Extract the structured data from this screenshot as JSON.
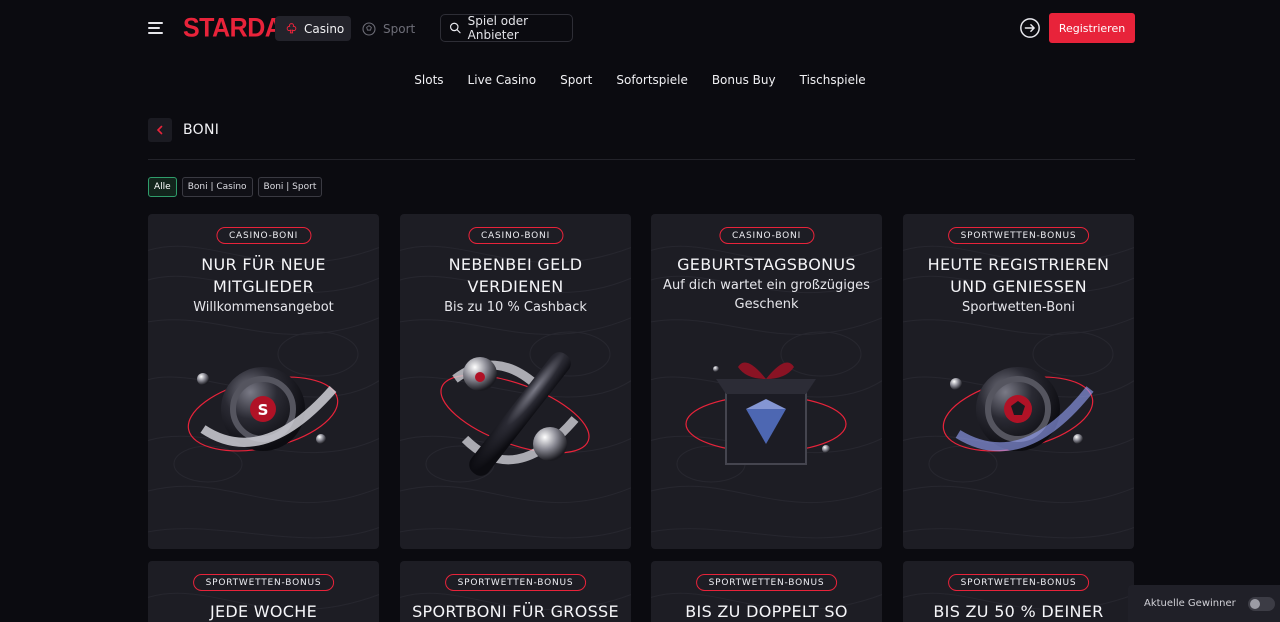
{
  "header": {
    "logo": "STARDA",
    "casino_tab": "Casino",
    "sport_tab": "Sport",
    "search_placeholder": "Spiel oder Anbieter",
    "register_label": "Registrieren"
  },
  "subnav": [
    "Slots",
    "Live Casino",
    "Sport",
    "Sofortspiele",
    "Bonus Buy",
    "Tischspiele"
  ],
  "page": {
    "title": "BONI"
  },
  "filters": [
    "Alle",
    "Boni | Casino",
    "Boni | Sport"
  ],
  "cards": [
    {
      "badge": "CASINO-BONI",
      "title": "NUR FÜR NEUE MITGLIEDER",
      "subtitle": "Willkommensangebot",
      "icon": "deposit-coin-icon"
    },
    {
      "badge": "CASINO-BONI",
      "title": "NEBENBEI GELD VERDIENEN",
      "subtitle": "Bis zu 10 % Cashback",
      "icon": "cashback-percent-icon"
    },
    {
      "badge": "CASINO-BONI",
      "title": "GEBURTSTAGSBONUS",
      "subtitle": "Auf dich wartet ein großzügiges Geschenk",
      "icon": "gift-box-icon"
    },
    {
      "badge": "SPORTWETTEN-BONUS",
      "title": "HEUTE REGISTRIEREN UND GENIESSEN",
      "subtitle": "Sportwetten-Boni",
      "icon": "deposit-ball-icon"
    },
    {
      "badge": "SPORTWETTEN-BONUS",
      "title": "JEDE WOCHE",
      "subtitle": ""
    },
    {
      "badge": "SPORTWETTEN-BONUS",
      "title": "SPORTBONI FÜR GROSSE",
      "subtitle": ""
    },
    {
      "badge": "SPORTWETTEN-BONUS",
      "title": "BIS ZU DOPPELT SO",
      "subtitle": ""
    },
    {
      "badge": "SPORTWETTEN-BONUS",
      "title": "BIS ZU 50 % DEINER",
      "subtitle": ""
    }
  ],
  "winners": {
    "label": "Aktuelle Gewinner"
  },
  "colors": {
    "accent": "#e8233a",
    "active_filter": "#2f9d6b",
    "background": "#0b0b10",
    "card": "#1d1d24"
  }
}
